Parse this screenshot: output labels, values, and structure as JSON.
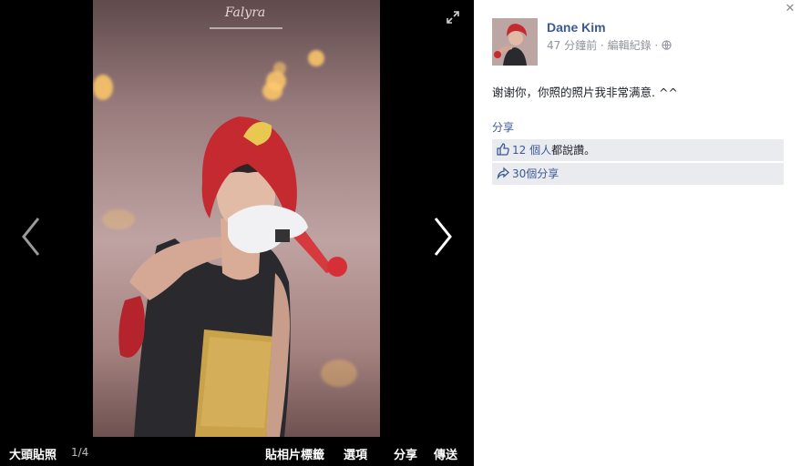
{
  "viewer": {
    "watermark": "Falyra",
    "bottom_left": {
      "profile_pictures_label": "大頭貼照",
      "counter": "1/4"
    },
    "bottom_right": {
      "tag_photo_label": "貼相片標籤",
      "options_label": "選項",
      "share_label": "分享",
      "send_label": "傳送"
    }
  },
  "post": {
    "author": "Dane Kim",
    "time": "47 分鐘前",
    "separator": "·",
    "edit_history": "編輯紀錄",
    "caption": "谢谢你，你照的照片我非常满意. ^^",
    "share_link": "分享",
    "likes": {
      "count_text": "12 個人",
      "suffix": "都說讚。"
    },
    "shares": {
      "text": "30個分享"
    }
  },
  "colors": {
    "link": "#3b5998",
    "ufi_bg": "#e9ebee",
    "meta": "#90949c"
  },
  "icons": [
    "expand-icon",
    "chevron-left-icon",
    "chevron-right-icon",
    "close-icon",
    "globe-icon",
    "thumbs-up-icon",
    "share-arrow-icon"
  ]
}
